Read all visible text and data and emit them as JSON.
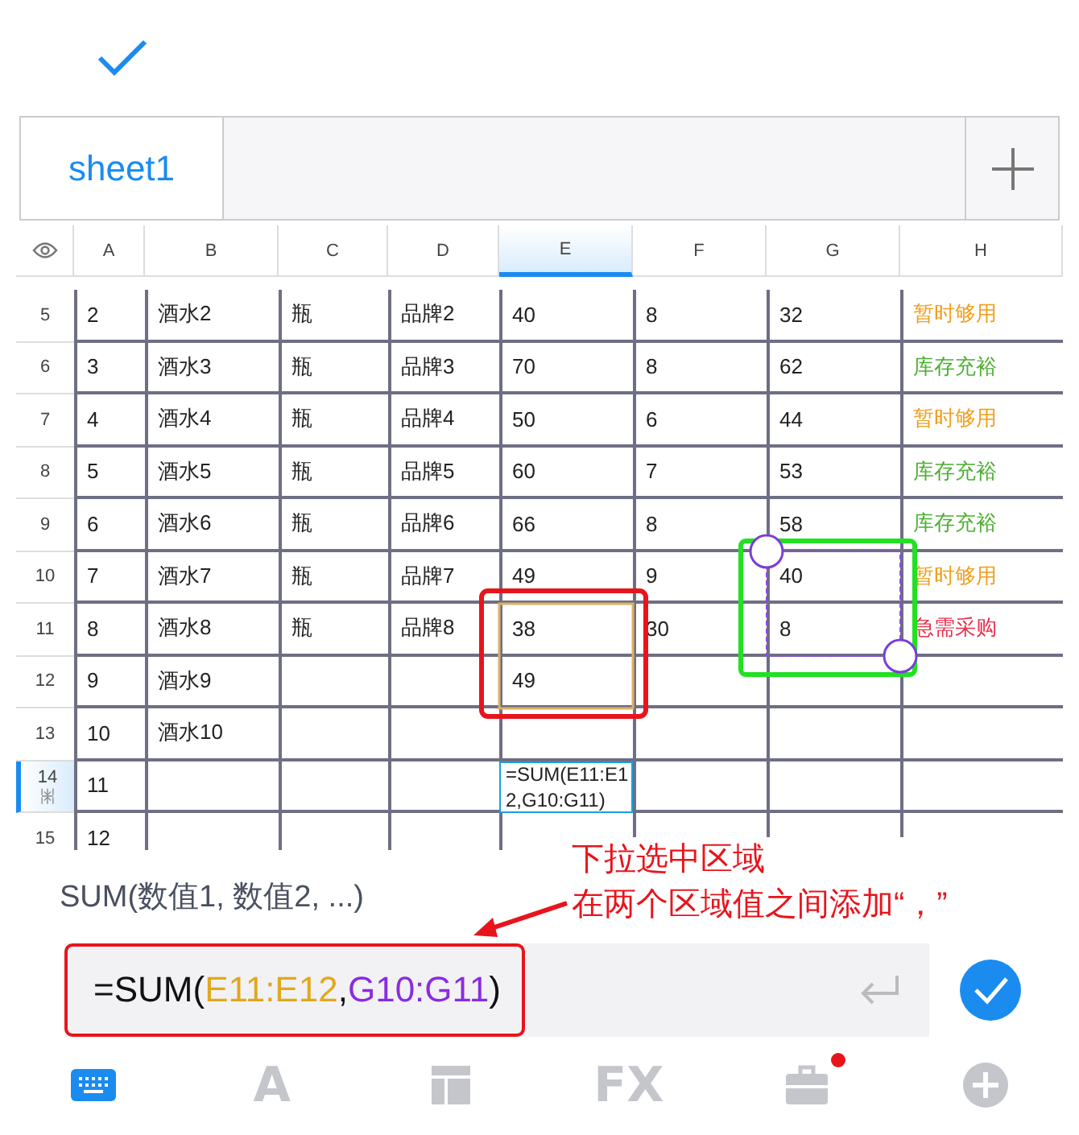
{
  "sheet_tabs": [
    {
      "label": "sheet1",
      "selected": true
    }
  ],
  "columns": [
    {
      "label": "A",
      "selected": false
    },
    {
      "label": "B",
      "selected": false
    },
    {
      "label": "C",
      "selected": false
    },
    {
      "label": "D",
      "selected": false
    },
    {
      "label": "E",
      "selected": true
    },
    {
      "label": "F",
      "selected": false
    },
    {
      "label": "G",
      "selected": false
    },
    {
      "label": "H",
      "selected": false
    }
  ],
  "rows": [
    {
      "num": "5",
      "selected": false,
      "cells": [
        "2",
        "酒水2",
        "瓶",
        "品牌2",
        "40",
        "8",
        "32",
        "暂时够用"
      ],
      "color": "#f0a020"
    },
    {
      "num": "6",
      "selected": false,
      "cells": [
        "3",
        "酒水3",
        "瓶",
        "品牌3",
        "70",
        "8",
        "62",
        "库存充裕"
      ],
      "color": "#4caf30"
    },
    {
      "num": "7",
      "selected": false,
      "cells": [
        "4",
        "酒水4",
        "瓶",
        "品牌4",
        "50",
        "6",
        "44",
        "暂时够用"
      ],
      "color": "#f0a020"
    },
    {
      "num": "8",
      "selected": false,
      "cells": [
        "5",
        "酒水5",
        "瓶",
        "品牌5",
        "60",
        "7",
        "53",
        "库存充裕"
      ],
      "color": "#4caf30"
    },
    {
      "num": "9",
      "selected": false,
      "cells": [
        "6",
        "酒水6",
        "瓶",
        "品牌6",
        "66",
        "8",
        "58",
        "库存充裕"
      ],
      "color": "#4caf30"
    },
    {
      "num": "10",
      "selected": false,
      "cells": [
        "7",
        "酒水7",
        "瓶",
        "品牌7",
        "49",
        "9",
        "40",
        "暂时够用"
      ],
      "color": "#f0a020"
    },
    {
      "num": "11",
      "selected": false,
      "cells": [
        "8",
        "酒水8",
        "瓶",
        "品牌8",
        "38",
        "30",
        "8",
        "急需采购"
      ],
      "color": "#e8304a"
    },
    {
      "num": "12",
      "selected": false,
      "cells": [
        "9",
        "酒水9",
        null,
        null,
        "49",
        null,
        null,
        null
      ]
    },
    {
      "num": "13",
      "selected": false,
      "cells": [
        "10",
        "酒水10",
        null,
        null,
        null,
        null,
        null,
        null
      ]
    },
    {
      "num": "14",
      "selected": true,
      "cells": [
        "11",
        null,
        null,
        null,
        "=SUM(E11:E12,G10:G11)",
        null,
        null,
        null
      ]
    },
    {
      "num": "15",
      "selected": false,
      "cells": [
        "12",
        null,
        null,
        null,
        null,
        null,
        null,
        null
      ]
    }
  ],
  "function_hint": "SUM(数值1, 数值2, ...)",
  "annotation": [
    "下拉选中区域",
    "在两个区域值之间添加“，”"
  ],
  "formula": [
    {
      "text": "=SUM(",
      "color": "#111111"
    },
    {
      "text": "E11:E12",
      "color": "#e0a81c"
    },
    {
      "text": ",",
      "color": "#111111"
    },
    {
      "text": "G10:G11",
      "color": "#8a2be2"
    },
    {
      "text": ")",
      "color": "#111111"
    }
  ],
  "toolbar": [
    {
      "kind": "keyboard",
      "selected": true,
      "badge": false
    },
    {
      "kind": "letter",
      "label": "A",
      "selected": false,
      "badge": false
    },
    {
      "kind": "layout",
      "selected": false,
      "badge": false
    },
    {
      "kind": "letter",
      "label": "FX",
      "selected": false,
      "badge": false
    },
    {
      "kind": "briefcase",
      "selected": false,
      "badge": true
    },
    {
      "kind": "plus",
      "selected": false,
      "badge": false
    }
  ]
}
